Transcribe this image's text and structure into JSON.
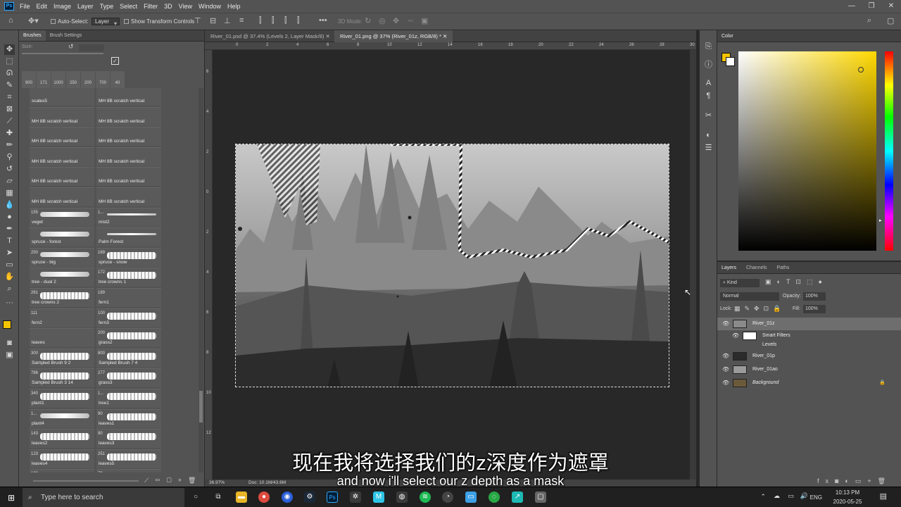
{
  "menu": {
    "app_icon": "Ps",
    "items": [
      "File",
      "Edit",
      "Image",
      "Layer",
      "Type",
      "Select",
      "Filter",
      "3D",
      "View",
      "Window",
      "Help"
    ],
    "window_controls": [
      "—",
      "❐",
      "✕"
    ]
  },
  "options_bar": {
    "auto_select_label": "Auto-Select:",
    "auto_select_target": "Layer",
    "show_transform_label": "Show Transform Controls",
    "more": "•••",
    "mode_3d": "3D Mode:"
  },
  "brush_panel": {
    "tabs": [
      "Brushes",
      "Brush Settings"
    ],
    "size_label": "Size:",
    "recent_sizes": [
      "900",
      "171",
      "1000",
      "250",
      "200",
      "700",
      "40"
    ],
    "cells": [
      {
        "num": "",
        "label": "scales5",
        "stroke": "none"
      },
      {
        "num": "",
        "label": "MH 8B scratch vertical",
        "stroke": "none"
      },
      {
        "num": "",
        "label": "MH 8B scratch vertical",
        "stroke": "none"
      },
      {
        "num": "",
        "label": "MH 8B scratch vertical",
        "stroke": "none"
      },
      {
        "num": "",
        "label": "MH 8B scratch vertical",
        "stroke": "none"
      },
      {
        "num": "",
        "label": "MH 8B scratch vertical",
        "stroke": "none"
      },
      {
        "num": "",
        "label": "MH 8B scratch vertical",
        "stroke": "none"
      },
      {
        "num": "",
        "label": "MH 8B scratch vertical",
        "stroke": "none"
      },
      {
        "num": "",
        "label": "MH 8B scratch vertical",
        "stroke": "none"
      },
      {
        "num": "",
        "label": "MH 8B scratch vertical",
        "stroke": "none"
      },
      {
        "num": "",
        "label": "MH 8B scratch vertical",
        "stroke": "none"
      },
      {
        "num": "",
        "label": "MH 8B scratch vertical",
        "stroke": "none"
      },
      {
        "num": "155",
        "label": "veget",
        "stroke": "soft"
      },
      {
        "num": "1...",
        "label": "mist2",
        "stroke": "thin"
      },
      {
        "num": "",
        "label": "spruce - forest",
        "stroke": "soft"
      },
      {
        "num": "",
        "label": "Palm Forest",
        "stroke": "thin"
      },
      {
        "num": "250",
        "label": "spruce - big",
        "stroke": "soft"
      },
      {
        "num": "169",
        "label": "spruce - snow",
        "stroke": "blob"
      },
      {
        "num": "",
        "label": "tree - dual 2",
        "stroke": "soft"
      },
      {
        "num": "172",
        "label": "tree crowns 1",
        "stroke": "blob"
      },
      {
        "num": "261",
        "label": "tree crowns 2",
        "stroke": "blob"
      },
      {
        "num": "189",
        "label": "fern1",
        "stroke": "none"
      },
      {
        "num": "111",
        "label": "fern2",
        "stroke": "none"
      },
      {
        "num": "100",
        "label": "fern3",
        "stroke": "blob"
      },
      {
        "num": "",
        "label": "leaves",
        "stroke": "none"
      },
      {
        "num": "200",
        "label": "grass2",
        "stroke": "blob"
      },
      {
        "num": "300",
        "label": "Sampled Brush 9 2",
        "stroke": "blob"
      },
      {
        "num": "800",
        "label": "Sampled Brush 7 4",
        "stroke": "blob"
      },
      {
        "num": "786",
        "label": "Sampled Brush 3 14",
        "stroke": "blob"
      },
      {
        "num": "277",
        "label": "grass3",
        "stroke": "blob"
      },
      {
        "num": "340",
        "label": "plant1",
        "stroke": "blob"
      },
      {
        "num": "1...",
        "label": "tree1",
        "stroke": "blob"
      },
      {
        "num": "1...",
        "label": "plant4",
        "stroke": "soft"
      },
      {
        "num": "90",
        "label": "leaves1",
        "stroke": "blob"
      },
      {
        "num": "143",
        "label": "leaves2",
        "stroke": "blob"
      },
      {
        "num": "90",
        "label": "leaves3",
        "stroke": "blob"
      },
      {
        "num": "123",
        "label": "leaves4",
        "stroke": "blob"
      },
      {
        "num": "251",
        "label": "leaves5",
        "stroke": "blob"
      },
      {
        "num": "100",
        "label": "",
        "stroke": "blob"
      },
      {
        "num": "70",
        "label": "",
        "stroke": "blob"
      }
    ]
  },
  "documents": {
    "tabs": [
      {
        "title": "River_01.psd @ 37.4% (Levels 2, Layer Mask/8)",
        "active": false
      },
      {
        "title": "River_01.png @ 37% (River_01z, RGB/8) *",
        "active": true
      }
    ],
    "ruler_top": [
      "0",
      "2",
      "4",
      "6",
      "8",
      "10",
      "12",
      "14",
      "16",
      "18",
      "20",
      "22",
      "24",
      "26",
      "28",
      "30"
    ],
    "ruler_left": [
      "6",
      "4",
      "2",
      "0",
      "2",
      "4",
      "6",
      "8",
      "10",
      "12"
    ],
    "zoom": "36.97%",
    "doc_size": "Doc: 10.1M/43.6M"
  },
  "color_panel": {
    "title": "Color",
    "foreground": "#f5c400",
    "background": "#ffffff"
  },
  "layers_panel": {
    "tabs": [
      "Layers",
      "Channels",
      "Paths"
    ],
    "filter": "Kind",
    "blend_mode": "Normal",
    "opacity_label": "Opacity:",
    "opacity": "100%",
    "lock_label": "Lock:",
    "fill_label": "Fill:",
    "fill": "100%",
    "layers": [
      {
        "name": "River_01z",
        "selected": true,
        "visible": true,
        "thumb": "#8a8a8a"
      },
      {
        "name": "Smart Filters",
        "selected": false,
        "visible": true,
        "thumb": "#ffffff"
      },
      {
        "name": "Levels",
        "selected": false,
        "visible": true,
        "thumb": ""
      },
      {
        "name": "River_01p",
        "selected": false,
        "visible": true,
        "thumb": "#2b2b2b"
      },
      {
        "name": "River_01ao",
        "selected": false,
        "visible": true,
        "thumb": "#9a9a9a"
      },
      {
        "name": "Background",
        "selected": false,
        "visible": true,
        "thumb": "#6b5a3a"
      }
    ]
  },
  "subtitles": {
    "zh": "现在我将选择我们的z深度作为遮罩",
    "en": "and now i'll select our z depth as a mask"
  },
  "taskbar": {
    "search_placeholder": "Type here to search",
    "language": "ENG",
    "time": "10:13 PM",
    "date": "2020-05-25"
  }
}
